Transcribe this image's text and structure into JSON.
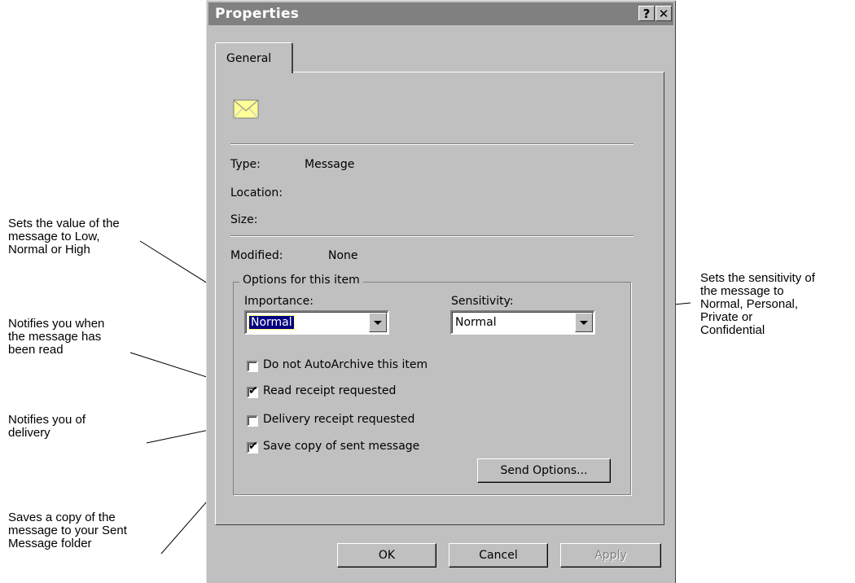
{
  "callouts": {
    "importance": "Sets the value of the\nmessage to Low,\nNormal or High",
    "read_receipt": "Notifies you when\nthe message has\nbeen read",
    "delivery": "Notifies you of\ndelivery",
    "save_copy": "Saves a copy of the\nmessage to your Sent\nMessage folder",
    "sensitivity": "Sets the sensitivity of\nthe message to\nNormal, Personal,\nPrivate or\nConfidential"
  },
  "dialog": {
    "title": "Properties",
    "help_label": "?",
    "close_label": "✕",
    "tab_label": "General",
    "icon": "envelope-icon",
    "type_label": "Type:",
    "type_value": "Message",
    "location_label": "Location:",
    "size_label": "Size:",
    "modified_label": "Modified:",
    "modified_value": "None",
    "group_title": "Options for this item",
    "importance_label": "Importance:",
    "importance_value": "Normal",
    "sensitivity_label": "Sensitivity:",
    "sensitivity_value": "Normal",
    "checkboxes": [
      {
        "label": "Do not AutoArchive this item",
        "checked": false
      },
      {
        "label": "Read receipt requested",
        "checked": true
      },
      {
        "label": "Delivery receipt requested",
        "checked": false
      },
      {
        "label": "Save copy of sent message",
        "checked": true
      }
    ],
    "check_glyph": "✔",
    "send_options_label": "Send Options...",
    "ok_label": "OK",
    "cancel_label": "Cancel",
    "apply_label": "Apply"
  },
  "colors": {
    "face": "#c0c0c0",
    "titlebar": "#808080",
    "selection": "#000080"
  }
}
